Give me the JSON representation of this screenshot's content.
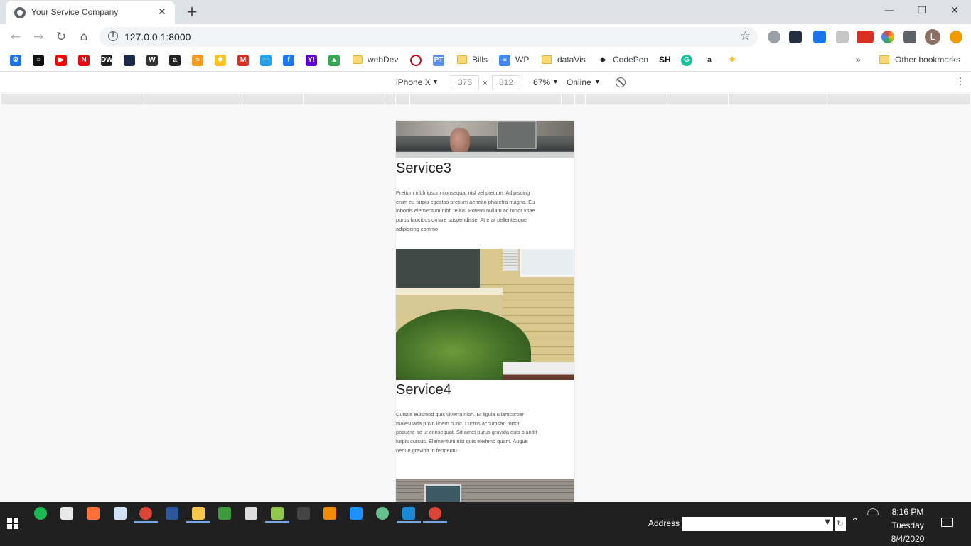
{
  "browser": {
    "tab_title": "Your Service Company",
    "tab_close": "✕",
    "new_tab": "+",
    "url": "127.0.0.1:8000",
    "controls": {
      "minimize": "—",
      "restore": "❐",
      "close": "✕"
    },
    "profile_initial": "L",
    "nav": {
      "back": "←",
      "forward": "→",
      "reload": "↻",
      "home": "⌂"
    }
  },
  "bookmarks": {
    "items": [
      {
        "icon": "gear-icon",
        "label": "",
        "color": "#1a73e8",
        "glyph": "⚙"
      },
      {
        "icon": "circle-icon",
        "label": "",
        "color": "#111111",
        "glyph": "○"
      },
      {
        "icon": "youtube-icon",
        "label": "",
        "color": "#ff0000",
        "glyph": "▶"
      },
      {
        "icon": "netflix-icon",
        "label": "",
        "color": "#e50914",
        "glyph": "N"
      },
      {
        "icon": "dw-icon",
        "label": "",
        "color": "#222222",
        "glyph": "DW"
      },
      {
        "icon": "wsj-icon",
        "label": "",
        "color": "#1b2a4a",
        "glyph": ""
      },
      {
        "icon": "wikipedia-icon",
        "label": "",
        "color": "#333333",
        "glyph": "W"
      },
      {
        "icon": "amazon-icon",
        "label": "",
        "color": "#222222",
        "glyph": "a"
      },
      {
        "icon": "audible-icon",
        "label": "",
        "color": "#f7991c",
        "glyph": "≈"
      },
      {
        "icon": "walmart-icon",
        "label": "",
        "color": "#ffc220",
        "glyph": "✱"
      },
      {
        "icon": "gmail-icon",
        "label": "",
        "color": "#d93025",
        "glyph": "M"
      },
      {
        "icon": "twitter-icon",
        "label": "",
        "color": "#1da1f2",
        "glyph": "🐦"
      },
      {
        "icon": "facebook-icon",
        "label": "",
        "color": "#1877f2",
        "glyph": "f"
      },
      {
        "icon": "yahoo-icon",
        "label": "",
        "color": "#6001d2",
        "glyph": "Y!"
      },
      {
        "icon": "drive-icon",
        "label": "",
        "color": "#34a853",
        "glyph": "▲"
      }
    ],
    "webdev": "webDev",
    "bills": "Bills",
    "wp": "WP",
    "datavis": "dataVis",
    "codepen": "CodePen",
    "sh": "SH",
    "overflow": "»",
    "other": "Other bookmarks"
  },
  "device_toolbar": {
    "device": "iPhone X",
    "width": "375",
    "times": "×",
    "height": "812",
    "zoom": "67%",
    "network": "Online",
    "menu": "⋮"
  },
  "page": {
    "services": [
      {
        "title": "Service3",
        "text": "Pretium nibh ipsum consequat nisl vel pretium. Adipiscing enim eu turpis egestas pretium aenean pharetra magna. Eu lobortis elementum nibh tellus. Potenti nullam ac tortor vitae purus faucibus ornare suspendisse. At erat pellentesque adipiscing commo"
      },
      {
        "title": "Service4",
        "text": "Cursus euismod quis viverra nibh. Et ligula ullamcorper malesuada proin libero nunc. Luctus accumsan tortor posuere ac ut consequat. Sit amet purus gravida quis blandit turpis cursus. Elementum nisi quis eleifend quam. Augue neque gravida in fermentu"
      }
    ]
  },
  "taskbar": {
    "address_label": "Address",
    "time": "8:16 PM",
    "day": "Tuesday",
    "date": "8/4/2020",
    "apps": [
      {
        "icon": "spotify-icon",
        "color": "#1db954"
      },
      {
        "icon": "store-icon",
        "color": "#e8e8e8"
      },
      {
        "icon": "firefox-icon",
        "color": "#ff7139"
      },
      {
        "icon": "notepad-icon",
        "color": "#cfe3f7"
      },
      {
        "icon": "chrome-icon",
        "color": "#db4437"
      },
      {
        "icon": "word-icon",
        "color": "#2b579a"
      },
      {
        "icon": "explorer-icon",
        "color": "#f8c64b"
      },
      {
        "icon": "app-h-icon",
        "color": "#3c9a3c"
      },
      {
        "icon": "github-icon",
        "color": "#dddddd"
      },
      {
        "icon": "notepadpp-icon",
        "color": "#90c84b"
      },
      {
        "icon": "terminal-icon",
        "color": "#444444"
      },
      {
        "icon": "vlc-icon",
        "color": "#f48b00"
      },
      {
        "icon": "app-blue-icon",
        "color": "#1e90ff"
      },
      {
        "icon": "atom-icon",
        "color": "#66c08a"
      },
      {
        "icon": "vscode-icon",
        "color": "#1a8ad4"
      },
      {
        "icon": "chrome2-icon",
        "color": "#db4437"
      }
    ]
  }
}
